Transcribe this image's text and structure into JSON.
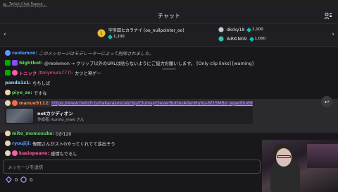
{
  "browser": {
    "tab_title": "Twitch Chat Popout",
    "url": "twitch.tv/popout/chat?popout="
  },
  "header": {
    "title": "チャット"
  },
  "leaderboard": {
    "first": {
      "name": "宇多田ヒカラナイ (oo_nullpointer_oo)",
      "points": "1,200"
    },
    "second": {
      "name": "dkcky18",
      "points": "1,100"
    },
    "third": {
      "name": "AiRKiNG9",
      "points": "1,000"
    }
  },
  "chat": {
    "messages": [
      {
        "user": "reolemon:",
        "text": "このメッセージはモデレーターによって削除されました。",
        "color": "#5c9cff"
      },
      {
        "user": "Nightbot:",
        "text": "@reolemon → クリップ以外のURLは貼らないようにご協力お願いします。 [Only clip links] [warning]",
        "color": "#5cd65c"
      },
      {
        "user": "トニック",
        "handle": "(tonymura777):",
        "text": "カツと神ゲー",
        "color": "#ff5ca8"
      },
      {
        "user": "panda1z1:",
        "text": "ちちしば",
        "color": "#8fd0ff"
      },
      {
        "user": "piyo_se:",
        "text": "ですな",
        "color": "#5cd65c"
      },
      {
        "user": "manue9112:",
        "text": "https://www.twitch.tv/takarasoscal/clip/ClumsyCleverButterAllenHuhu-6f15MBo_wped0u69",
        "color": "#ff8a3d"
      },
      {
        "user": "mito_momosuke:",
        "text": "0か120",
        "color": "#5cd65c"
      },
      {
        "user": "ryoujiji:",
        "text": "俺聞さんがストGやってくれてて涙出そう",
        "color": "#5c9cff"
      },
      {
        "user": "kasiopeano:",
        "text": "感情もでるし",
        "color": "#ff5ca8"
      }
    ],
    "clip": {
      "title": "notカツディオン",
      "author": "作成者: kuroto_maw さん"
    }
  },
  "input": {
    "placeholder": "メッセージを送信"
  },
  "footer": {
    "bits": "0",
    "points": "0"
  },
  "colors": {
    "accent": "#bf94ff",
    "gem": "#00c8af"
  }
}
